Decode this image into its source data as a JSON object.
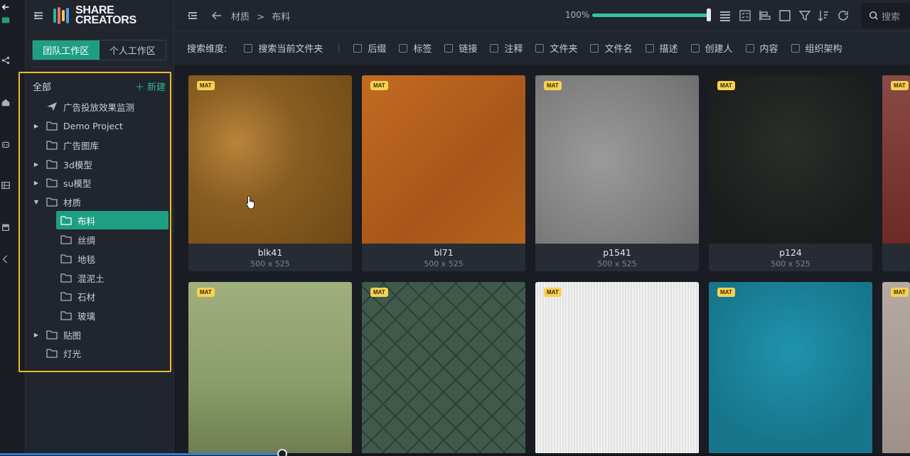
{
  "rail": {
    "icons": [
      "back-arrow-icon",
      "video-icon",
      "share-icon",
      "home-icon",
      "robot-icon",
      "layout-icon",
      "store-icon",
      "collapse-icon"
    ]
  },
  "brand": {
    "line1": "SHARE",
    "line2": "CREATORS"
  },
  "workspace_tabs": [
    {
      "label": "团队工作区",
      "active": true
    },
    {
      "label": "个人工作区",
      "active": false
    }
  ],
  "tree": {
    "header": "全部",
    "new_label": "新建",
    "items": [
      {
        "label": "广告投放效果监测",
        "icon": "send-icon",
        "caret": false,
        "level": 0
      },
      {
        "label": "Demo Project",
        "icon": "folder-icon",
        "caret": true,
        "level": 0
      },
      {
        "label": "广告图库",
        "icon": "folder-icon",
        "caret": false,
        "level": 0
      },
      {
        "label": "3d模型",
        "icon": "folder-icon",
        "caret": true,
        "level": 0
      },
      {
        "label": "su模型",
        "icon": "folder-icon",
        "caret": true,
        "level": 0
      },
      {
        "label": "材质",
        "icon": "folder-icon",
        "caret": "down",
        "level": 0
      },
      {
        "label": "布料",
        "icon": "folder-icon",
        "caret": false,
        "level": 1,
        "selected": true
      },
      {
        "label": "丝绸",
        "icon": "folder-icon",
        "caret": false,
        "level": 1
      },
      {
        "label": "地毯",
        "icon": "folder-icon",
        "caret": false,
        "level": 1
      },
      {
        "label": "混泥土",
        "icon": "folder-icon",
        "caret": false,
        "level": 1
      },
      {
        "label": "石材",
        "icon": "folder-icon",
        "caret": false,
        "level": 1
      },
      {
        "label": "玻璃",
        "icon": "folder-icon",
        "caret": false,
        "level": 1
      },
      {
        "label": "贴图",
        "icon": "folder-icon",
        "caret": true,
        "level": 0
      },
      {
        "label": "灯光",
        "icon": "folder-icon",
        "caret": false,
        "level": 0
      }
    ]
  },
  "toolbar": {
    "breadcrumb_parent": "材质",
    "breadcrumb_sep": ">",
    "breadcrumb_current": "布料",
    "zoom_label": "100%",
    "zoom_fraction": 1.0,
    "search_placeholder": "搜索",
    "icons": [
      "list-view-icon",
      "checklist-icon",
      "align-icon",
      "square-icon",
      "filter-icon",
      "sort-icon",
      "refresh-icon"
    ]
  },
  "filters": {
    "label": "搜索维度:",
    "current_folder": "搜索当前文件夹",
    "options": [
      "后缀",
      "标签",
      "链接",
      "注释",
      "文件夹",
      "文件名",
      "描述",
      "创建人",
      "内容",
      "组织架构"
    ]
  },
  "badge": "MAT",
  "cards": [
    {
      "name": "blk41",
      "size": "500 x 525",
      "tex": "tex-1"
    },
    {
      "name": "bl71",
      "size": "500 x 525",
      "tex": "tex-2"
    },
    {
      "name": "p1541",
      "size": "500 x 525",
      "tex": "tex-3"
    },
    {
      "name": "p124",
      "size": "500 x 525",
      "tex": "tex-4"
    },
    {
      "name": "",
      "size": "",
      "tex": "tex-5"
    },
    {
      "name": "",
      "size": "",
      "tex": "tex-6"
    },
    {
      "name": "",
      "size": "",
      "tex": "tex-7"
    },
    {
      "name": "",
      "size": "",
      "tex": "tex-8"
    },
    {
      "name": "",
      "size": "",
      "tex": "tex-9"
    },
    {
      "name": "",
      "size": "",
      "tex": "tex-10"
    }
  ],
  "colors": {
    "accent": "#1e9f84",
    "highlight_border": "#f1b823",
    "badge": "#f7d154"
  }
}
